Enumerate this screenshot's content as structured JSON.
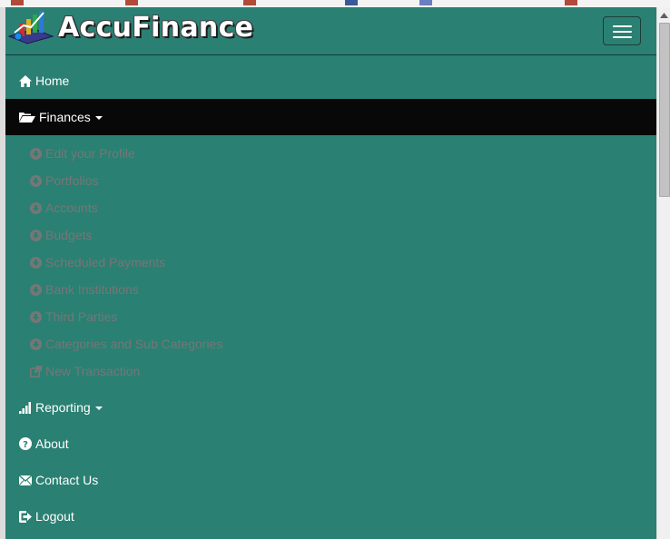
{
  "brand": {
    "name": "AccuFinance"
  },
  "navbar": {
    "toggle_icon": "hamburger-menu-icon"
  },
  "menu": {
    "home": {
      "label": "Home",
      "icon": "home-icon"
    },
    "finances": {
      "label": "Finances",
      "icon": "folder-open-icon",
      "expanded": true,
      "items": [
        {
          "label": "Edit your Profile",
          "icon": "circle-arrow-down-icon"
        },
        {
          "label": "Portfolios",
          "icon": "circle-arrow-down-icon"
        },
        {
          "label": "Accounts",
          "icon": "circle-arrow-down-icon"
        },
        {
          "label": "Budgets",
          "icon": "circle-arrow-down-icon"
        },
        {
          "label": "Scheduled Payments",
          "icon": "circle-arrow-down-icon"
        },
        {
          "label": "Bank Institutions",
          "icon": "circle-arrow-down-icon"
        },
        {
          "label": "Third Parties",
          "icon": "circle-arrow-down-icon"
        },
        {
          "label": "Categories and Sub Categories",
          "icon": "circle-arrow-down-icon"
        },
        {
          "label": "New Transaction",
          "icon": "external-link-icon"
        }
      ]
    },
    "reporting": {
      "label": "Reporting",
      "icon": "signal-bars-icon"
    },
    "about": {
      "label": "About",
      "icon": "question-circle-icon"
    },
    "contact": {
      "label": "Contact Us",
      "icon": "envelope-icon"
    },
    "logout": {
      "label": "Logout",
      "icon": "logout-icon"
    }
  },
  "colors": {
    "navbar_bg": "#2a8073",
    "active_bg": "#080808",
    "submenu_text": "#767676",
    "menu_text": "#ffffff"
  }
}
